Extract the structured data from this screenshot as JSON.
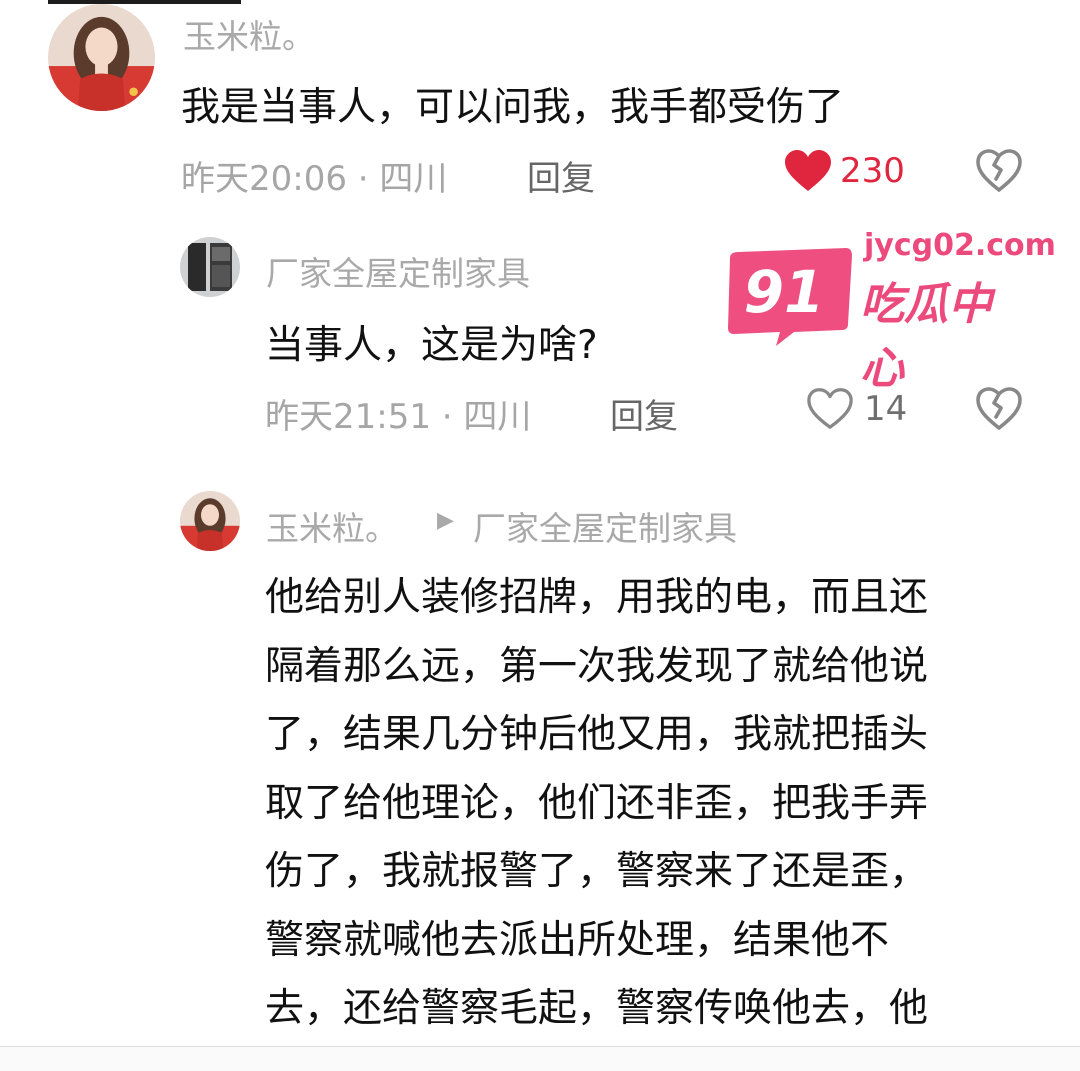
{
  "comments": [
    {
      "username": "玉米粒。",
      "text": "我是当事人，可以问我，我手都受伤了",
      "meta": "昨天20:06 · 四川",
      "reply_label": "回复",
      "likes": "230",
      "liked": true
    },
    {
      "username": "厂家全屋定制家具",
      "text": "当事人，这是为啥?",
      "meta": "昨天21:51 · 四川",
      "reply_label": "回复",
      "likes": "14",
      "liked": false
    },
    {
      "username": "玉米粒。",
      "reply_to": "厂家全屋定制家具",
      "text_lines": [
        "他给别人装修招牌，用我的电，而且还",
        "隔着那么远，第一次我发现了就给他说",
        "了，结果几分钟后他又用，我就把插头",
        "取了给他理论，他们还非歪，把我手弄",
        "伤了，我就报警了，警察来了还是歪，",
        "警察就喊他去派出所处理，结果他不",
        "去，还给警察毛起，警察传唤他去，他"
      ]
    }
  ],
  "watermark": {
    "number": "91",
    "url": "jycg02.com",
    "name": "吃瓜中心"
  },
  "colors": {
    "like_active": "#e0263f",
    "watermark": "#ec4a7c"
  },
  "icons": [
    "heart-filled-icon",
    "heart-outline-icon",
    "broken-heart-icon",
    "play-arrow-icon"
  ]
}
